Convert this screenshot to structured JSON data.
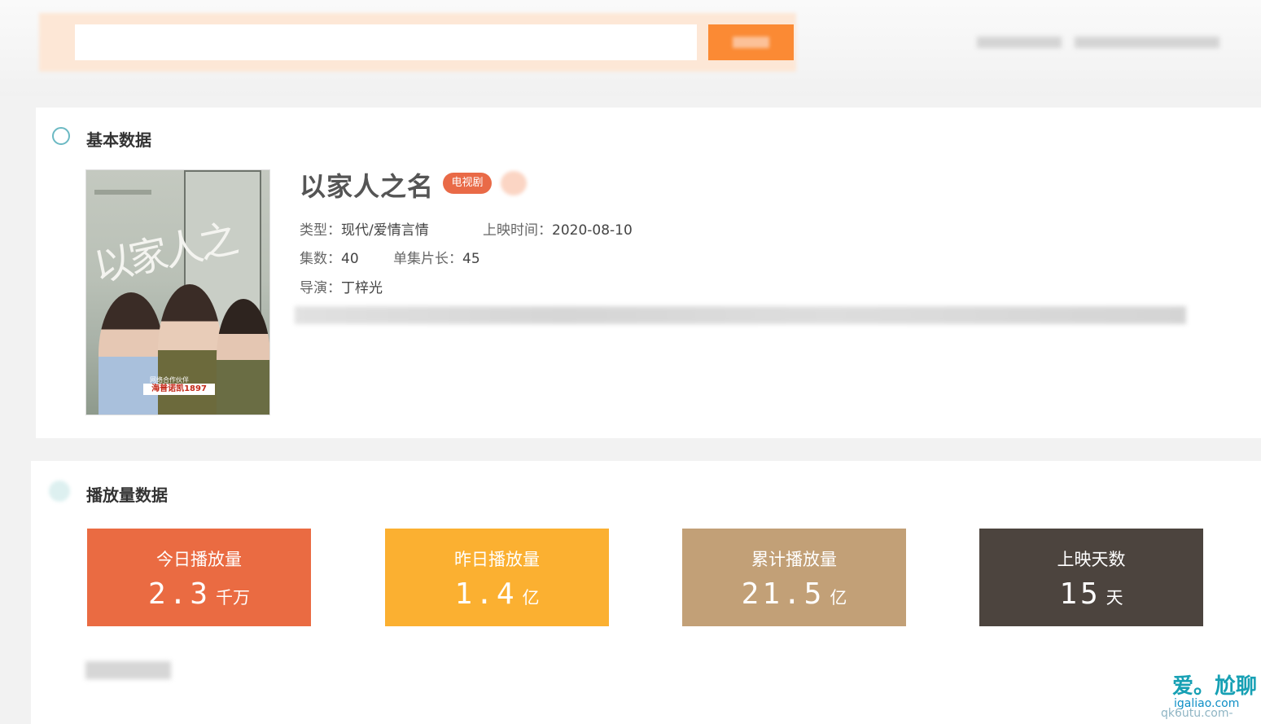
{
  "search": {
    "placeholder": ""
  },
  "section_basic": {
    "title": "基本数据"
  },
  "drama": {
    "title": "以家人之名",
    "badge": "电视剧",
    "poster": {
      "title_text": "以家人之名",
      "tagline": "网络合作伙伴",
      "sponsor": "海普诺凯1897"
    },
    "genre_label": "类型：",
    "genre": "现代/爱情言情",
    "release_label": "上映时间：",
    "release": "2020-08-10",
    "episodes_label": "集数：",
    "episodes": "40",
    "length_label": "单集片长：",
    "length": "45",
    "director_label": "导演：",
    "director": "丁梓光"
  },
  "section_play": {
    "title": "播放量数据"
  },
  "stats": [
    {
      "label": "今日播放量",
      "value": "2.3",
      "unit": "千万",
      "color": "#ea6b42"
    },
    {
      "label": "昨日播放量",
      "value": "1.4",
      "unit": "亿",
      "color": "#fbb031"
    },
    {
      "label": "累计播放量",
      "value": "21.5",
      "unit": "亿",
      "color": "#c2a077"
    },
    {
      "label": "上映天数",
      "value": "15",
      "unit": "天",
      "color": "#4c443e"
    }
  ],
  "watermark": {
    "text": "爱。尬聊",
    "url": "igaliao.com",
    "url2": "qk6utu.com-"
  },
  "colors": {
    "accent": "#fb8a34",
    "ring": "#6bb9c3",
    "badge": "#e96a47"
  }
}
